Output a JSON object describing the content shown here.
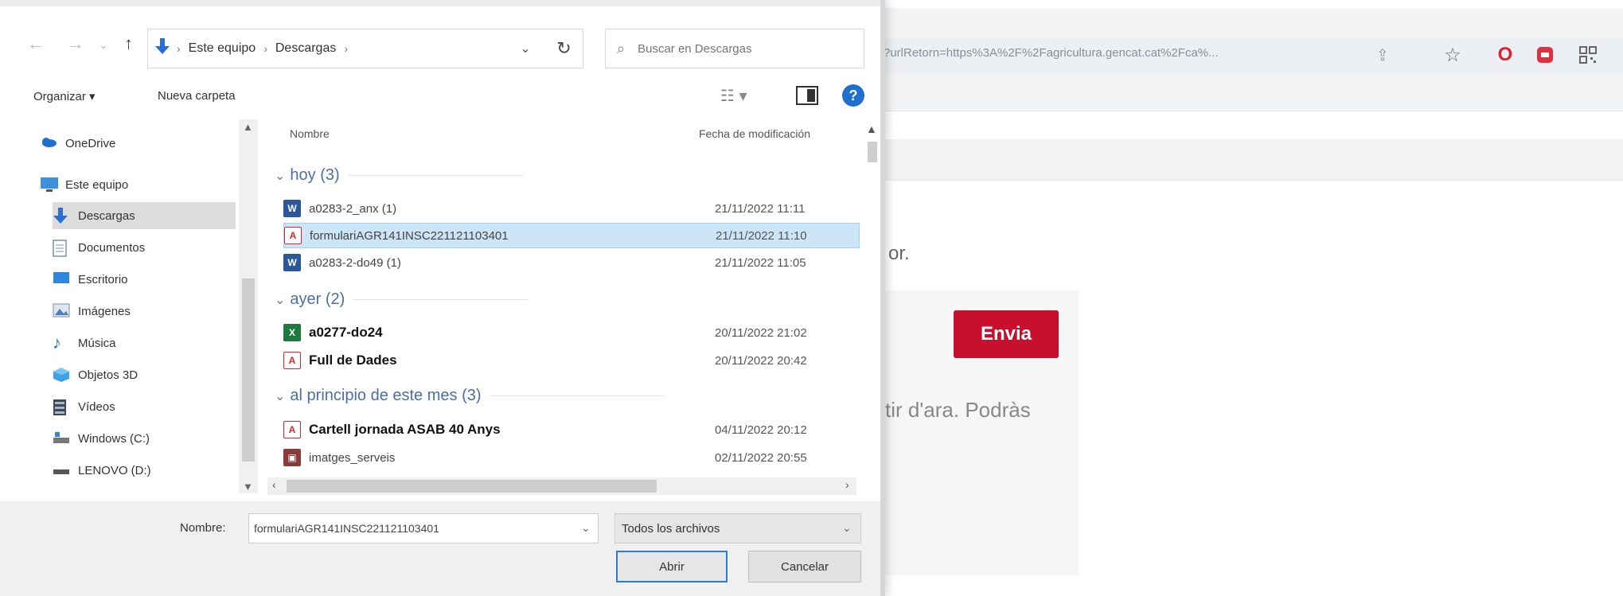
{
  "browser": {
    "url": "?urlRetorn=https%3A%2F%2Fagricultura.gencat.cat%2Fca%...",
    "icons": [
      "share-icon",
      "star-icon",
      "opera-icon",
      "extension-icon",
      "qr-icon"
    ],
    "page_text_1": "or.",
    "submit_label": "Envia",
    "page_text_2": "tir d'ara. Podràs"
  },
  "dialog": {
    "address": {
      "crumbs": [
        "Este equipo",
        "Descargas"
      ]
    },
    "search_placeholder": "Buscar en Descargas",
    "toolbar": {
      "organize_label": "Organizar ▾",
      "new_folder_label": "Nueva carpeta"
    },
    "nav_pane": {
      "items": [
        {
          "label": "OneDrive",
          "icon": "cloud-icon"
        },
        {
          "label": "Este equipo",
          "icon": "computer-icon"
        },
        {
          "label": "Descargas",
          "icon": "download-icon"
        },
        {
          "label": "Documentos",
          "icon": "document-icon"
        },
        {
          "label": "Escritorio",
          "icon": "desktop-icon"
        },
        {
          "label": "Imágenes",
          "icon": "image-icon"
        },
        {
          "label": "Música",
          "icon": "music-icon"
        },
        {
          "label": "Objetos 3D",
          "icon": "cube-icon"
        },
        {
          "label": "Vídeos",
          "icon": "video-icon"
        },
        {
          "label": "Windows (C:)",
          "icon": "drive-icon"
        },
        {
          "label": "LENOVO (D:)",
          "icon": "drive-icon"
        }
      ]
    },
    "columns": {
      "name": "Nombre",
      "date": "Fecha de modificación"
    },
    "groups": [
      {
        "label": "hoy (3)",
        "files": [
          {
            "name": "a0283-2_anx (1)",
            "date": "21/11/2022 11:11",
            "type": "word"
          },
          {
            "name": "formulariAGR141INSC221121103401",
            "date": "21/11/2022 11:10",
            "type": "pdf"
          },
          {
            "name": "a0283-2-do49 (1)",
            "date": "21/11/2022 11:05",
            "type": "word"
          }
        ]
      },
      {
        "label": "ayer (2)",
        "files": [
          {
            "name": "a0277-do24",
            "date": "20/11/2022 21:02",
            "type": "excel"
          },
          {
            "name": "Full de Dades",
            "date": "20/11/2022 20:42",
            "type": "pdf"
          }
        ]
      },
      {
        "label": "al principio de este mes (3)",
        "files": [
          {
            "name": "Cartell jornada ASAB 40 Anys",
            "date": "04/11/2022 20:12",
            "type": "pdf"
          },
          {
            "name": "imatges_serveis",
            "date": "02/11/2022 20:55",
            "type": "image"
          }
        ]
      }
    ],
    "bottom": {
      "filename_label": "Nombre:",
      "filename_value": "formulariAGR141INSC221121103401",
      "filetype_value": "Todos los archivos",
      "open_label": "Abrir",
      "cancel_label": "Cancelar"
    },
    "colors": {
      "selection": "#cde6f7",
      "accent": "#1f6fd1",
      "brand_red": "#c8102e"
    }
  }
}
